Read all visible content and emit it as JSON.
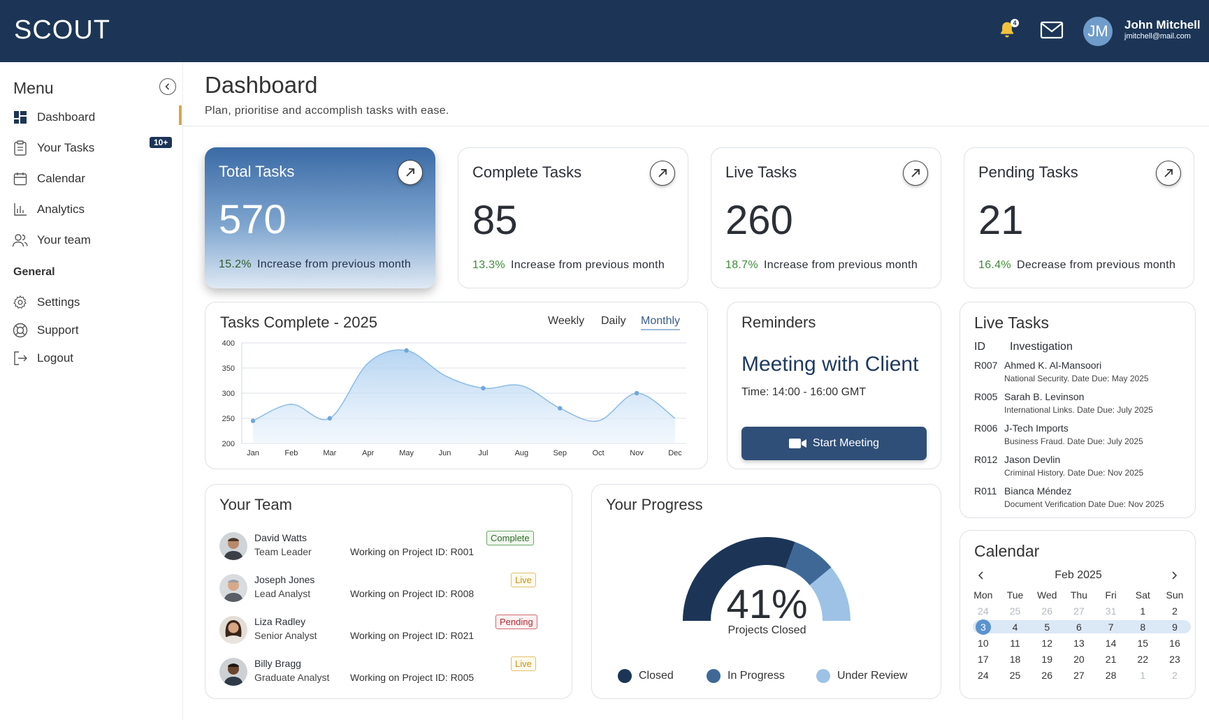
{
  "app": {
    "brand": "SCOUT"
  },
  "topbar": {
    "notifications_count": "4",
    "user": {
      "initials": "JM",
      "name": "John Mitchell",
      "email": "jmitchell@mail.com"
    }
  },
  "sidebar": {
    "menu_title": "Menu",
    "items": [
      {
        "label": "Dashboard",
        "icon": "grid-icon",
        "active": true
      },
      {
        "label": "Your Tasks",
        "icon": "clipboard-icon",
        "badge": "10+"
      },
      {
        "label": "Calendar",
        "icon": "calendar-icon"
      },
      {
        "label": "Analytics",
        "icon": "bar-chart-icon"
      },
      {
        "label": "Your team",
        "icon": "users-icon"
      }
    ],
    "general_label": "General",
    "general_items": [
      {
        "label": "Settings",
        "icon": "gear-icon"
      },
      {
        "label": "Support",
        "icon": "lifebuoy-icon"
      },
      {
        "label": "Logout",
        "icon": "logout-icon"
      }
    ]
  },
  "header": {
    "title": "Dashboard",
    "subtitle": "Plan, prioritise and accomplish tasks with ease."
  },
  "stats": [
    {
      "title": "Total Tasks",
      "value": "570",
      "pct": "15.2%",
      "desc": "Increase from previous month"
    },
    {
      "title": "Complete Tasks",
      "value": "85",
      "pct": "13.3%",
      "desc": "Increase from previous month"
    },
    {
      "title": "Live Tasks",
      "value": "260",
      "pct": "18.7%",
      "desc": "Increase from previous month"
    },
    {
      "title": "Pending Tasks",
      "value": "21",
      "pct": "16.4%",
      "desc": "Decrease from previous month"
    }
  ],
  "chart_section": {
    "tabs": [
      "Weekly",
      "Daily",
      "Monthly"
    ],
    "active_tab": "Monthly"
  },
  "chart_data": {
    "type": "area",
    "title": "Tasks Complete - 2025",
    "categories": [
      "Jan",
      "Feb",
      "Mar",
      "Apr",
      "May",
      "Jun",
      "Jul",
      "Aug",
      "Sep",
      "Oct",
      "Nov",
      "Dec"
    ],
    "values": [
      245,
      278,
      250,
      360,
      385,
      335,
      310,
      315,
      270,
      245,
      300,
      250
    ],
    "marked_indices": [
      0,
      2,
      4,
      6,
      8,
      10
    ],
    "yticks": [
      200,
      250,
      300,
      350,
      400
    ],
    "ylim": [
      200,
      400
    ],
    "grid": true,
    "color": "#7fb2e0"
  },
  "reminders": {
    "title": "Reminders",
    "event": "Meeting with Client",
    "time": "Time: 14:00 - 16:00 GMT",
    "button_label": "Start Meeting"
  },
  "live_tasks": {
    "title": "Live Tasks",
    "col_id": "ID",
    "col_inv": "Investigation",
    "rows": [
      {
        "id": "R007",
        "name": "Ahmed K. Al-Mansoori",
        "sub": "National Security.  Date Due: May 2025"
      },
      {
        "id": "R005",
        "name": "Sarah B. Levinson",
        "sub": "International Links.  Date Due: July 2025"
      },
      {
        "id": "R006",
        "name": "J-Tech Imports",
        "sub": "Business Fraud.  Date Due: July 2025"
      },
      {
        "id": "R012",
        "name": "Jason Devlin",
        "sub": "Criminal History.  Date Due: Nov 2025"
      },
      {
        "id": "R011",
        "name": "Bianca Méndez",
        "sub": "Document Verification  Date Due: Nov 2025"
      }
    ]
  },
  "team": {
    "title": "Your Team",
    "members": [
      {
        "name": "David Watts",
        "role": "Team Leader",
        "work": "Working on Project ID: R001",
        "status": "Complete"
      },
      {
        "name": "Joseph Jones",
        "role": "Lead Analyst",
        "work": "Working on Project ID: R008",
        "status": "Live"
      },
      {
        "name": "Liza Radley",
        "role": "Senior Analyst",
        "work": "Working on Project ID: R021",
        "status": "Pending"
      },
      {
        "name": "Billy Bragg",
        "role": "Graduate Analyst",
        "work": "Working on Project ID: R005",
        "status": "Live"
      }
    ]
  },
  "progress": {
    "title": "Your Progress",
    "value": "41%",
    "caption": "Projects Closed",
    "segments": [
      {
        "label": "Closed",
        "fraction": 0.61,
        "color": "#1c3556"
      },
      {
        "label": "In Progress",
        "fraction": 0.17,
        "color": "#3f6896"
      },
      {
        "label": "Under Review",
        "fraction": 0.22,
        "color": "#9dc2e6"
      }
    ]
  },
  "calendar": {
    "title": "Calendar",
    "month": "Feb 2025",
    "weekdays": [
      "Mon",
      "Tue",
      "Wed",
      "Thu",
      "Fri",
      "Sat",
      "Sun"
    ],
    "weeks": [
      [
        "24",
        "25",
        "26",
        "27",
        "31",
        "1",
        "2"
      ],
      [
        "3",
        "4",
        "5",
        "6",
        "7",
        "8",
        "9"
      ],
      [
        "10",
        "11",
        "12",
        "13",
        "14",
        "15",
        "16"
      ],
      [
        "17",
        "18",
        "19",
        "20",
        "21",
        "22",
        "23"
      ],
      [
        "24",
        "25",
        "26",
        "27",
        "28",
        "1",
        "2"
      ]
    ],
    "today": "3",
    "highlight_week": 1
  }
}
